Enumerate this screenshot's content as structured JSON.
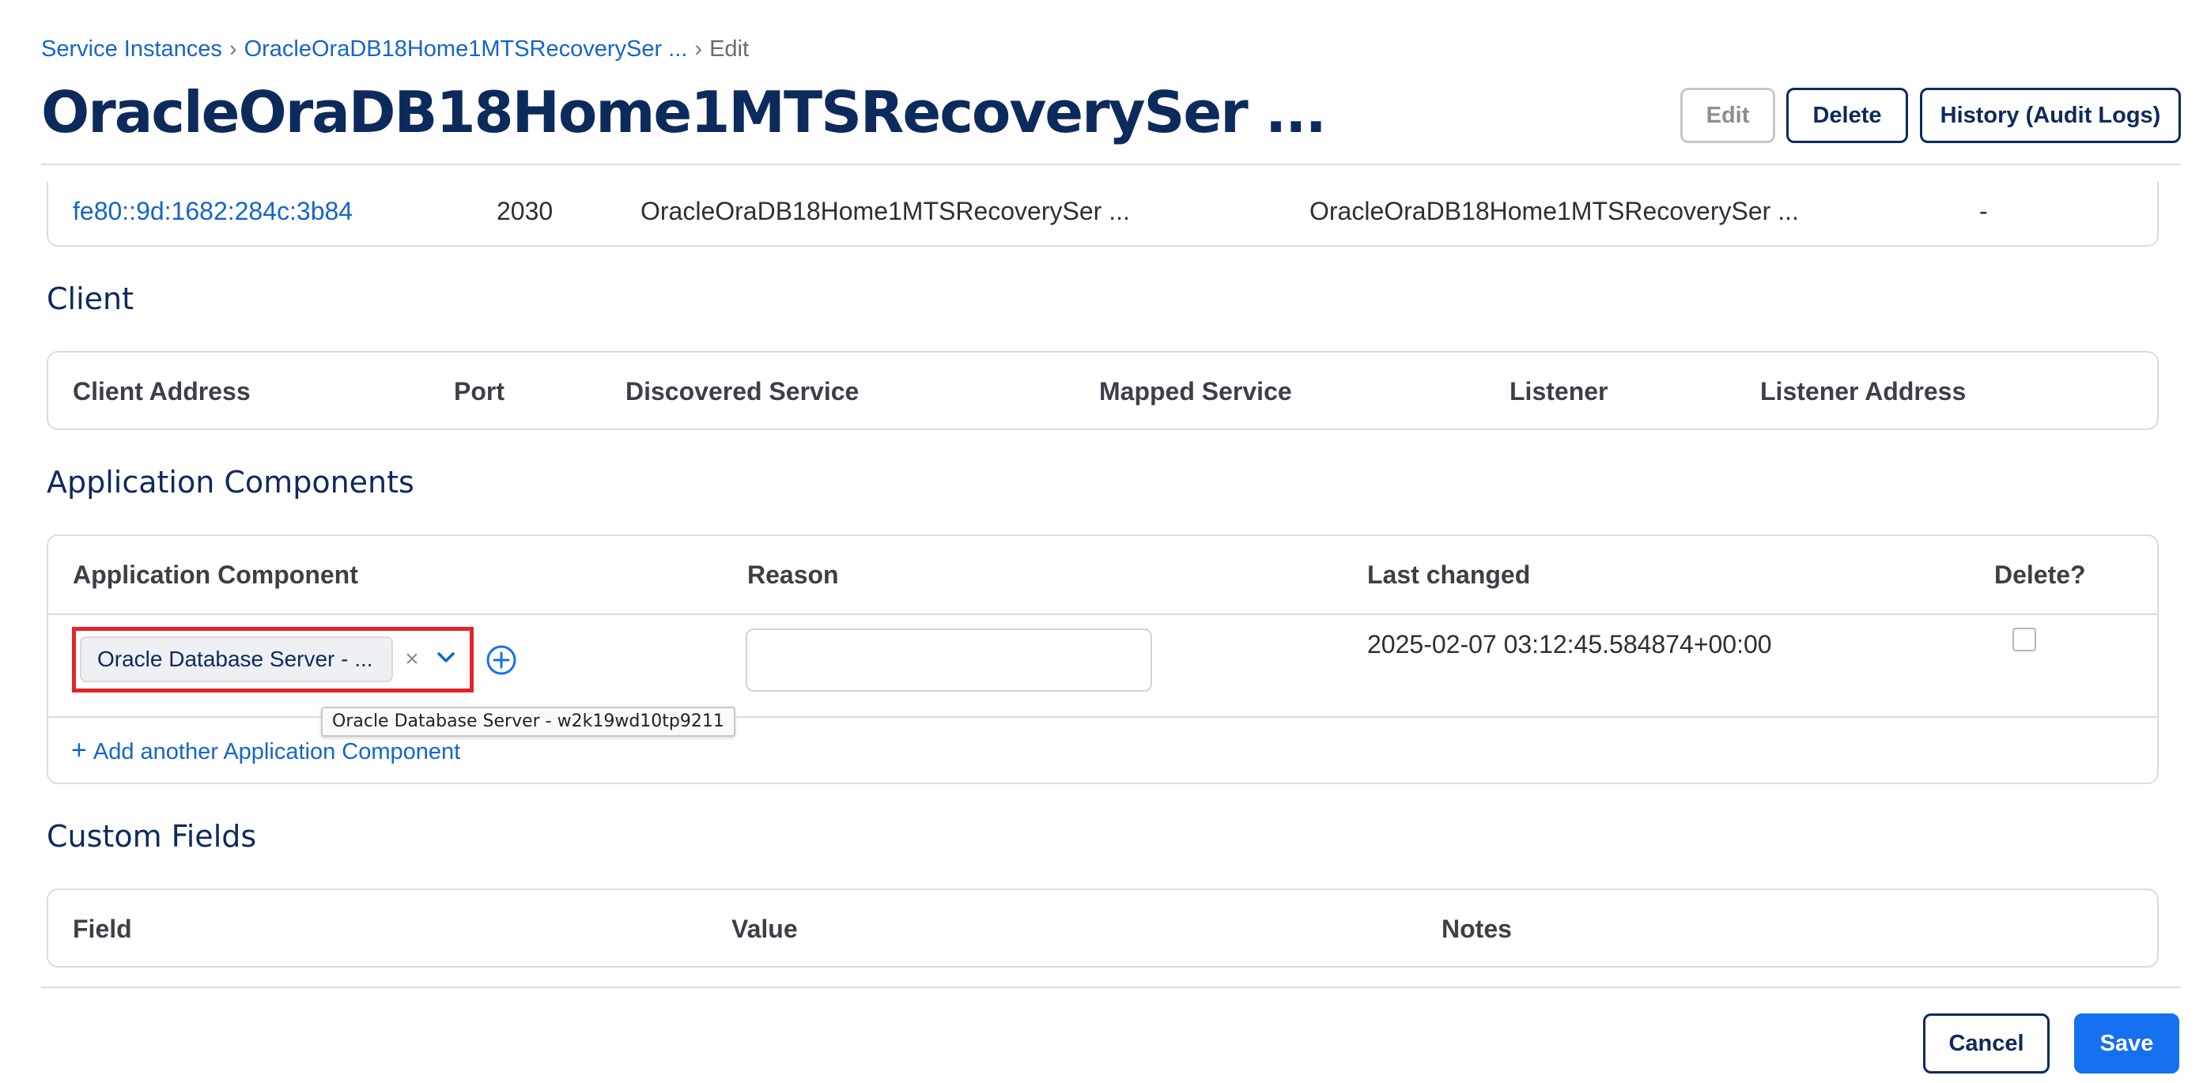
{
  "breadcrumb": {
    "items": [
      "Service Instances",
      "OracleOraDB18Home1MTSRecoverySer ..."
    ],
    "separator": "›",
    "current": "Edit"
  },
  "page_title": "OracleOraDB18Home1MTSRecoverySer ...",
  "header_buttons": {
    "edit": "Edit",
    "delete": "Delete",
    "history": "History (Audit Logs)"
  },
  "server_row": {
    "address": "fe80::9d:1682:284c:3b84",
    "port": "2030",
    "discovered_service": "OracleOraDB18Home1MTSRecoverySer ...",
    "mapped_service": "OracleOraDB18Home1MTSRecoverySer ...",
    "listener": "-"
  },
  "client": {
    "title": "Client",
    "columns": [
      "Client Address",
      "Port",
      "Discovered Service",
      "Mapped Service",
      "Listener",
      "Listener Address"
    ]
  },
  "application_components": {
    "title": "Application Components",
    "columns": [
      "Application Component",
      "Reason",
      "Last changed",
      "Delete?"
    ],
    "rows": [
      {
        "component": "Oracle Database Server - ...",
        "tooltip": "Oracle Database Server - w2k19wd10tp9211",
        "reason_value": "",
        "last_changed": "2025-02-07 03:12:45.584874+00:00"
      }
    ],
    "add_link": "Add another Application Component",
    "add_link_plus": "+"
  },
  "custom_fields": {
    "title": "Custom Fields",
    "columns": [
      "Field",
      "Value",
      "Notes"
    ]
  },
  "footer_buttons": {
    "cancel": "Cancel",
    "save": "Save"
  },
  "icons": {
    "clear": "×",
    "accent_color": "#1570ef",
    "highlight_color": "#e3242b",
    "title_color": "#0d2a5c",
    "link_color": "#1565c8"
  }
}
